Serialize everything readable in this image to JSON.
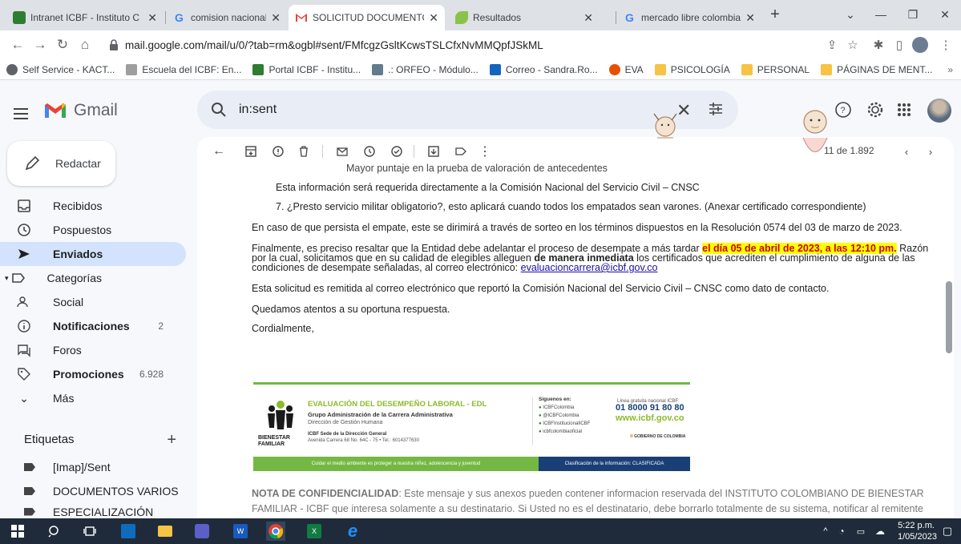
{
  "browser": {
    "tabs": [
      {
        "title": "Intranet ICBF - Instituto C",
        "fav": "#2e7d32"
      },
      {
        "title": "comision nacional del ser",
        "fav": "#4285f4"
      },
      {
        "title": "SOLICITUD DOCUMENTO",
        "fav": "#ea4335"
      },
      {
        "title": "Resultados",
        "fav": "#8bc34a"
      },
      {
        "title": "mercado libre colombia -",
        "fav": "#4285f4"
      }
    ],
    "url": "mail.google.com/mail/u/0/?tab=rm&ogbl#sent/FMfcgzGsltKcwsTSLCfxNvMMQpfJSkML",
    "bookmarks": [
      {
        "label": "Self Service - KACT...",
        "color": "#5f6368"
      },
      {
        "label": "Escuela del ICBF: En...",
        "color": "#9e9e9e"
      },
      {
        "label": "Portal ICBF - Institu...",
        "color": "#2e7d32"
      },
      {
        "label": ".: ORFEO - Módulo...",
        "color": "#607d8b"
      },
      {
        "label": "Correo - Sandra.Ro...",
        "color": "#1565c0"
      },
      {
        "label": "EVA",
        "color": "#e65100"
      },
      {
        "label": "PSICOLOGÍA",
        "color": "#f6c344"
      },
      {
        "label": "PERSONAL",
        "color": "#f6c344"
      },
      {
        "label": "PÁGINAS DE MENT...",
        "color": "#f6c344"
      }
    ]
  },
  "gmail": {
    "app_name": "Gmail",
    "search_value": "in:sent",
    "compose_label": "Redactar",
    "nav": [
      {
        "label": "Recibidos",
        "icon": "inbox-icon"
      },
      {
        "label": "Pospuestos",
        "icon": "clock-icon"
      },
      {
        "label": "Enviados",
        "icon": "send-icon"
      },
      {
        "label": "Categorías",
        "icon": "label-outline-icon"
      },
      {
        "label": "Social",
        "icon": "people-icon"
      },
      {
        "label": "Notificaciones",
        "icon": "info-icon",
        "count": "2"
      },
      {
        "label": "Foros",
        "icon": "forum-icon"
      },
      {
        "label": "Promociones",
        "icon": "tag-icon",
        "count": "6.928"
      },
      {
        "label": "Más",
        "icon": "chevron-down-icon"
      }
    ],
    "labels_header": "Etiquetas",
    "labels": [
      "[Imap]/Sent",
      "DOCUMENTOS VARIOS",
      "ESPECIALIZACIÓN"
    ],
    "pager": "11 de 1.892"
  },
  "email": {
    "cut_line": "Mayor puntaje en la prueba de valoración de antecedentes",
    "p1": "Esta información será requerida directamente a la Comisión Nacional del Servicio Civil – CNSC",
    "p2": "7. ¿Presto servicio militar obligatorio?, esto aplicará cuando todos los empatados sean varones. (Anexar certificado correspondiente)",
    "p3": "En caso de que persista el empate, este se dirimirá a través de sorteo en los términos dispuestos en la Resolución 0574 del 03 de marzo de 2023.",
    "p4a": "Finalmente, es preciso resaltar que la Entidad debe adelantar el proceso de desempate a más tardar ",
    "p4_highlight": "el día 05 de abril de 2023, a las 12:10 pm.",
    "p4b": " Razón por la cual, solicitamos que en su calidad de elegibles alleguen ",
    "p4_bold": "de manera inmediata",
    "p4c": " los certificados que acrediten el cumplimiento de alguna de las condiciones de desempate señaladas, al correo electrónico: ",
    "p4_email": "evaluacioncarrera@icbf.gov.co",
    "p5": "Esta solicitud es remitida al correo electrónico que reportó la Comisión Nacional del Servicio Civil – CNSC como dato de contacto.",
    "p6": "Quedamos atentos a su oportuna respuesta.",
    "p7": "Cordialmente,",
    "conf_title": "NOTA DE CONFIDENCIALIDAD",
    "conf_text": ": Este mensaje y sus anexos pueden contener informacion reservada del INSTITUTO COLOMBIANO DE BIENESTAR FAMILIAR - ICBF que interesa solamente a su destinatario. Si Usted no es el destinatario, debe borrarlo totalmente de su sistema, notificar al remitente"
  },
  "signature": {
    "title": "EVALUACIÓN DEL DESEMPEÑO LABORAL - EDL",
    "group": "Grupo Administración de la Carrera Administrativa",
    "dir": "Dirección de Gestión Humana",
    "brand1": "BIENESTAR",
    "brand2": "FAMILIAR",
    "address_b": "ICBF Sede de la Dirección General",
    "address": "Avenida Carrera 68 No. 64C - 75 • Tel.: 6014377630",
    "follow": "Síguenos en:",
    "social": [
      "ICBFColombia",
      "@ICBFColombia",
      "ICBFInstitucionalICBF",
      "icbfcolombiaoficial"
    ],
    "line_label": "Línea gratuita nacional ICBF:",
    "phone": "01 8000 91 80 80",
    "web": "www.icbf.gov.co",
    "gov": "GOBIERNO DE COLOMBIA",
    "footer_left": "Cuidar el medio ambiente es proteger a nuestra niñez, adolescencia y juventud",
    "footer_right": "Clasificación de la información: CLASIFICADA"
  },
  "taskbar": {
    "time": "5:22 p.m.",
    "date": "1/05/2023"
  }
}
